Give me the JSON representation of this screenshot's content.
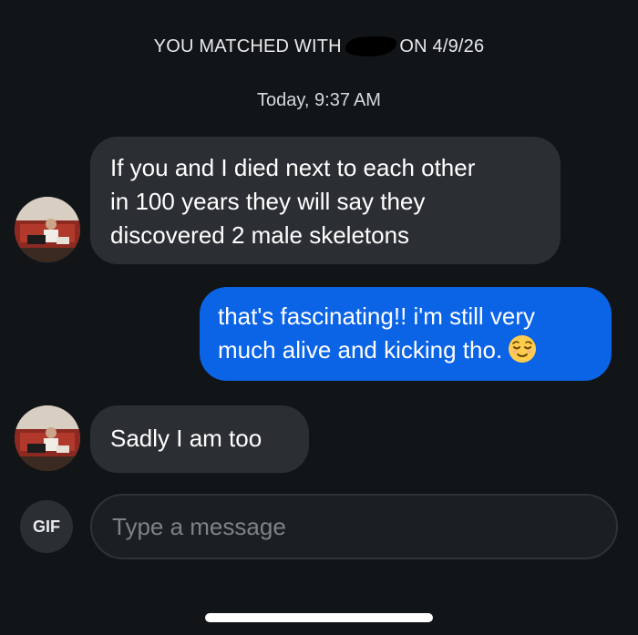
{
  "header": {
    "match_prefix": "YOU MATCHED WITH",
    "match_suffix": "ON 4/9/26",
    "timestamp": "Today, 9:37 AM"
  },
  "messages": [
    {
      "direction": "incoming",
      "lines": [
        "If you and I died next to each other",
        "in 100 years they will say they",
        "discovered 2 male skeletons"
      ]
    },
    {
      "direction": "outgoing",
      "lines": [
        "that's fascinating!! i'm still very",
        "much alive and kicking tho."
      ],
      "emoji": "relieved-face"
    },
    {
      "direction": "incoming",
      "lines": [
        "Sadly I am too"
      ]
    }
  ],
  "composer": {
    "gif_label": "GIF",
    "placeholder": "Type a message"
  },
  "colors": {
    "background": "#111518",
    "incoming_bubble": "#2b2f33",
    "outgoing_bubble": "#0b63e5",
    "text": "#ffffff"
  }
}
